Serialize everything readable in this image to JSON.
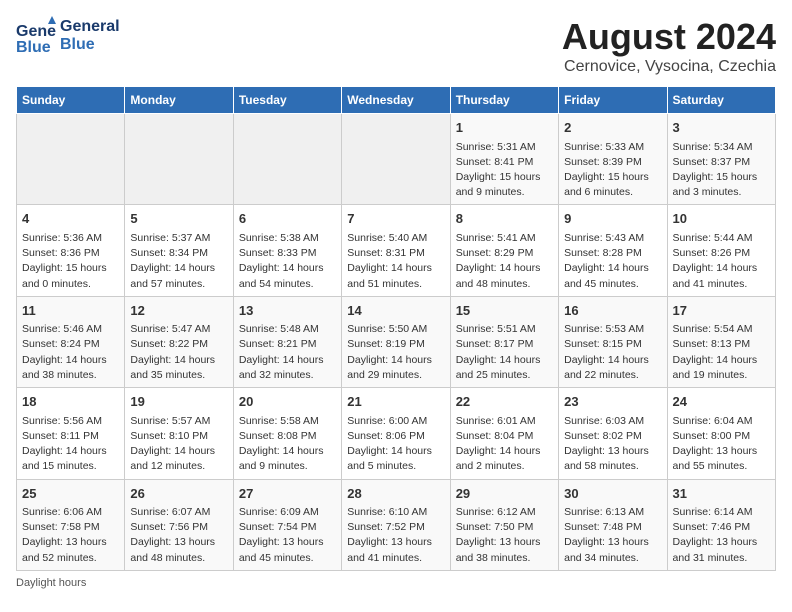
{
  "header": {
    "logo_line1": "General",
    "logo_line2": "Blue",
    "month_title": "August 2024",
    "subtitle": "Cernovice, Vysocina, Czechia"
  },
  "days_of_week": [
    "Sunday",
    "Monday",
    "Tuesday",
    "Wednesday",
    "Thursday",
    "Friday",
    "Saturday"
  ],
  "weeks": [
    [
      {
        "day": "",
        "info": ""
      },
      {
        "day": "",
        "info": ""
      },
      {
        "day": "",
        "info": ""
      },
      {
        "day": "",
        "info": ""
      },
      {
        "day": "1",
        "info": "Sunrise: 5:31 AM\nSunset: 8:41 PM\nDaylight: 15 hours\nand 9 minutes."
      },
      {
        "day": "2",
        "info": "Sunrise: 5:33 AM\nSunset: 8:39 PM\nDaylight: 15 hours\nand 6 minutes."
      },
      {
        "day": "3",
        "info": "Sunrise: 5:34 AM\nSunset: 8:37 PM\nDaylight: 15 hours\nand 3 minutes."
      }
    ],
    [
      {
        "day": "4",
        "info": "Sunrise: 5:36 AM\nSunset: 8:36 PM\nDaylight: 15 hours\nand 0 minutes."
      },
      {
        "day": "5",
        "info": "Sunrise: 5:37 AM\nSunset: 8:34 PM\nDaylight: 14 hours\nand 57 minutes."
      },
      {
        "day": "6",
        "info": "Sunrise: 5:38 AM\nSunset: 8:33 PM\nDaylight: 14 hours\nand 54 minutes."
      },
      {
        "day": "7",
        "info": "Sunrise: 5:40 AM\nSunset: 8:31 PM\nDaylight: 14 hours\nand 51 minutes."
      },
      {
        "day": "8",
        "info": "Sunrise: 5:41 AM\nSunset: 8:29 PM\nDaylight: 14 hours\nand 48 minutes."
      },
      {
        "day": "9",
        "info": "Sunrise: 5:43 AM\nSunset: 8:28 PM\nDaylight: 14 hours\nand 45 minutes."
      },
      {
        "day": "10",
        "info": "Sunrise: 5:44 AM\nSunset: 8:26 PM\nDaylight: 14 hours\nand 41 minutes."
      }
    ],
    [
      {
        "day": "11",
        "info": "Sunrise: 5:46 AM\nSunset: 8:24 PM\nDaylight: 14 hours\nand 38 minutes."
      },
      {
        "day": "12",
        "info": "Sunrise: 5:47 AM\nSunset: 8:22 PM\nDaylight: 14 hours\nand 35 minutes."
      },
      {
        "day": "13",
        "info": "Sunrise: 5:48 AM\nSunset: 8:21 PM\nDaylight: 14 hours\nand 32 minutes."
      },
      {
        "day": "14",
        "info": "Sunrise: 5:50 AM\nSunset: 8:19 PM\nDaylight: 14 hours\nand 29 minutes."
      },
      {
        "day": "15",
        "info": "Sunrise: 5:51 AM\nSunset: 8:17 PM\nDaylight: 14 hours\nand 25 minutes."
      },
      {
        "day": "16",
        "info": "Sunrise: 5:53 AM\nSunset: 8:15 PM\nDaylight: 14 hours\nand 22 minutes."
      },
      {
        "day": "17",
        "info": "Sunrise: 5:54 AM\nSunset: 8:13 PM\nDaylight: 14 hours\nand 19 minutes."
      }
    ],
    [
      {
        "day": "18",
        "info": "Sunrise: 5:56 AM\nSunset: 8:11 PM\nDaylight: 14 hours\nand 15 minutes."
      },
      {
        "day": "19",
        "info": "Sunrise: 5:57 AM\nSunset: 8:10 PM\nDaylight: 14 hours\nand 12 minutes."
      },
      {
        "day": "20",
        "info": "Sunrise: 5:58 AM\nSunset: 8:08 PM\nDaylight: 14 hours\nand 9 minutes."
      },
      {
        "day": "21",
        "info": "Sunrise: 6:00 AM\nSunset: 8:06 PM\nDaylight: 14 hours\nand 5 minutes."
      },
      {
        "day": "22",
        "info": "Sunrise: 6:01 AM\nSunset: 8:04 PM\nDaylight: 14 hours\nand 2 minutes."
      },
      {
        "day": "23",
        "info": "Sunrise: 6:03 AM\nSunset: 8:02 PM\nDaylight: 13 hours\nand 58 minutes."
      },
      {
        "day": "24",
        "info": "Sunrise: 6:04 AM\nSunset: 8:00 PM\nDaylight: 13 hours\nand 55 minutes."
      }
    ],
    [
      {
        "day": "25",
        "info": "Sunrise: 6:06 AM\nSunset: 7:58 PM\nDaylight: 13 hours\nand 52 minutes."
      },
      {
        "day": "26",
        "info": "Sunrise: 6:07 AM\nSunset: 7:56 PM\nDaylight: 13 hours\nand 48 minutes."
      },
      {
        "day": "27",
        "info": "Sunrise: 6:09 AM\nSunset: 7:54 PM\nDaylight: 13 hours\nand 45 minutes."
      },
      {
        "day": "28",
        "info": "Sunrise: 6:10 AM\nSunset: 7:52 PM\nDaylight: 13 hours\nand 41 minutes."
      },
      {
        "day": "29",
        "info": "Sunrise: 6:12 AM\nSunset: 7:50 PM\nDaylight: 13 hours\nand 38 minutes."
      },
      {
        "day": "30",
        "info": "Sunrise: 6:13 AM\nSunset: 7:48 PM\nDaylight: 13 hours\nand 34 minutes."
      },
      {
        "day": "31",
        "info": "Sunrise: 6:14 AM\nSunset: 7:46 PM\nDaylight: 13 hours\nand 31 minutes."
      }
    ]
  ],
  "footer": {
    "note": "Daylight hours"
  }
}
